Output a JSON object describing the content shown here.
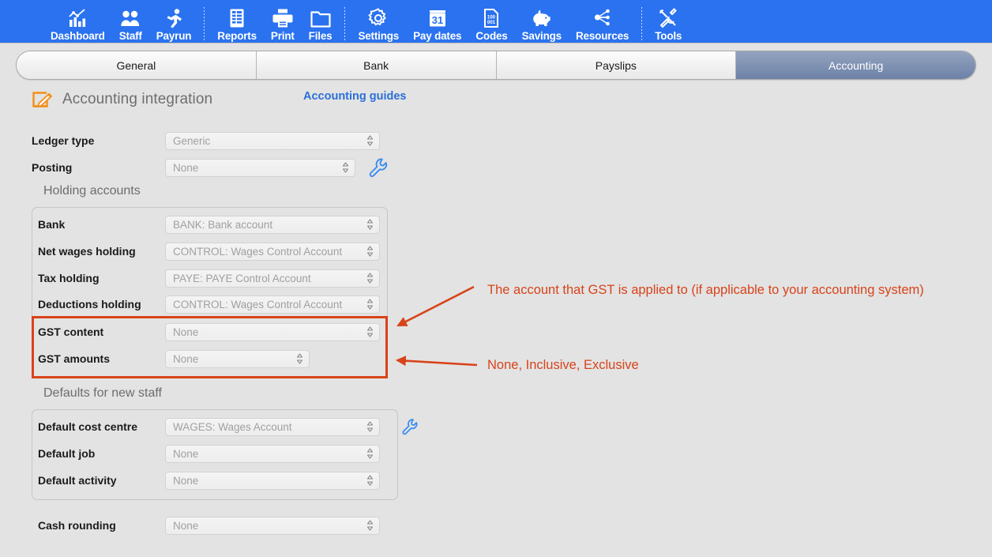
{
  "toolbar": {
    "items": [
      {
        "label": "Dashboard",
        "icon": "chart-bars-icon"
      },
      {
        "label": "Staff",
        "icon": "people-icon"
      },
      {
        "label": "Payrun",
        "icon": "runner-icon"
      },
      {
        "label": "Reports",
        "icon": "report-document-icon"
      },
      {
        "label": "Print",
        "icon": "printer-icon"
      },
      {
        "label": "Files",
        "icon": "folder-icon"
      },
      {
        "label": "Settings",
        "icon": "gear-icon"
      },
      {
        "label": "Pay dates",
        "icon": "calendar-icon",
        "calendar_day": "31"
      },
      {
        "label": "Codes",
        "icon": "barcode-document-icon",
        "code_lines": [
          "100",
          "001"
        ]
      },
      {
        "label": "Savings",
        "icon": "piggy-bank-icon"
      },
      {
        "label": "Resources",
        "icon": "network-nodes-icon"
      },
      {
        "label": "Tools",
        "icon": "tools-icon"
      }
    ],
    "separator_after": [
      2,
      5,
      10
    ],
    "background_color": "#2a72ef"
  },
  "tabs": [
    {
      "label": "General",
      "active": false
    },
    {
      "label": "Bank",
      "active": false
    },
    {
      "label": "Payslips",
      "active": false
    },
    {
      "label": "Accounting",
      "active": true
    }
  ],
  "header": {
    "title": "Accounting integration",
    "icon": "edit-pencil-icon",
    "link": "Accounting guides",
    "link_color": "#2b6fd8"
  },
  "form": {
    "ledger_type": {
      "label": "Ledger type",
      "value": "Generic"
    },
    "posting": {
      "label": "Posting",
      "value": "None",
      "tool_icon": "wrench-icon"
    }
  },
  "holding_accounts": {
    "title": "Holding accounts",
    "rows": [
      {
        "label": "Bank",
        "value": "BANK: Bank account"
      },
      {
        "label": "Net wages holding",
        "value": "CONTROL: Wages Control Account"
      },
      {
        "label": "Tax holding",
        "value": "PAYE: PAYE Control Account"
      },
      {
        "label": "Deductions holding",
        "value": "CONTROL: Wages Control Account"
      },
      {
        "label": "GST content",
        "value": "None"
      },
      {
        "label": "GST amounts",
        "value": "None"
      }
    ]
  },
  "defaults_new_staff": {
    "title": "Defaults for new staff",
    "rows": [
      {
        "label": "Default cost centre",
        "value": "WAGES: Wages Account"
      },
      {
        "label": "Default job",
        "value": "None"
      },
      {
        "label": "Default activity",
        "value": "None"
      }
    ],
    "tool_icon": "wrench-icon"
  },
  "cash_rounding": {
    "label": "Cash rounding",
    "value": "None"
  },
  "annotations": {
    "color": "#d8431a",
    "note_gst_content": "The account that GST is applied to (if applicable to your accounting system)",
    "note_gst_amounts": "None, Inclusive, Exclusive"
  }
}
